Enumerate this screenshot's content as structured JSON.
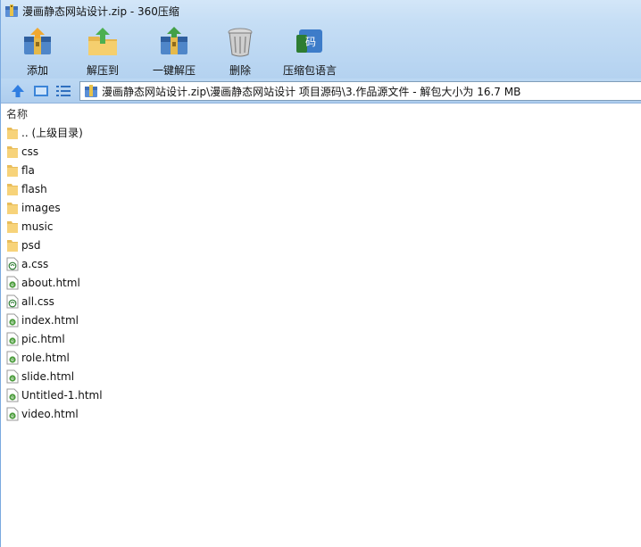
{
  "window": {
    "title": "漫画静态网站设计.zip - 360压缩"
  },
  "toolbar": {
    "buttons": [
      {
        "label": "添加",
        "icon": "add-archive-icon"
      },
      {
        "label": "解压到",
        "icon": "extract-to-icon"
      },
      {
        "label": "一键解压",
        "icon": "one-click-extract-icon"
      },
      {
        "label": "删除",
        "icon": "trash-bin-icon"
      },
      {
        "label": "压缩包语言",
        "icon": "archive-language-icon"
      }
    ]
  },
  "navigation": {
    "up_icon": "up-arrow-icon",
    "view_icon": "thumbnail-view-icon",
    "list_icon": "list-view-icon",
    "path": "漫画静态网站设计.zip\\漫画静态网站设计 项目源码\\3.作品源文件 - 解包大小为 16.7 MB"
  },
  "list_header": {
    "name_column": "名称"
  },
  "files": [
    {
      "name": ".. (上级目录)",
      "type": "folder"
    },
    {
      "name": "css",
      "type": "folder"
    },
    {
      "name": "fla",
      "type": "folder"
    },
    {
      "name": "flash",
      "type": "folder"
    },
    {
      "name": "images",
      "type": "folder"
    },
    {
      "name": "music",
      "type": "folder"
    },
    {
      "name": "psd",
      "type": "folder"
    },
    {
      "name": "a.css",
      "type": "css"
    },
    {
      "name": "about.html",
      "type": "html"
    },
    {
      "name": "all.css",
      "type": "css"
    },
    {
      "name": "index.html",
      "type": "html"
    },
    {
      "name": "pic.html",
      "type": "html"
    },
    {
      "name": "role.html",
      "type": "html"
    },
    {
      "name": "slide.html",
      "type": "html"
    },
    {
      "name": "Untitled-1.html",
      "type": "html"
    },
    {
      "name": "video.html",
      "type": "html"
    }
  ],
  "colors": {
    "folder": "#f7d37a",
    "html_badge": "#3c8a2e",
    "css_badge": "#2e7d32",
    "titlebar": "#d3e6f8",
    "toolbar": "#bfdaf4"
  }
}
